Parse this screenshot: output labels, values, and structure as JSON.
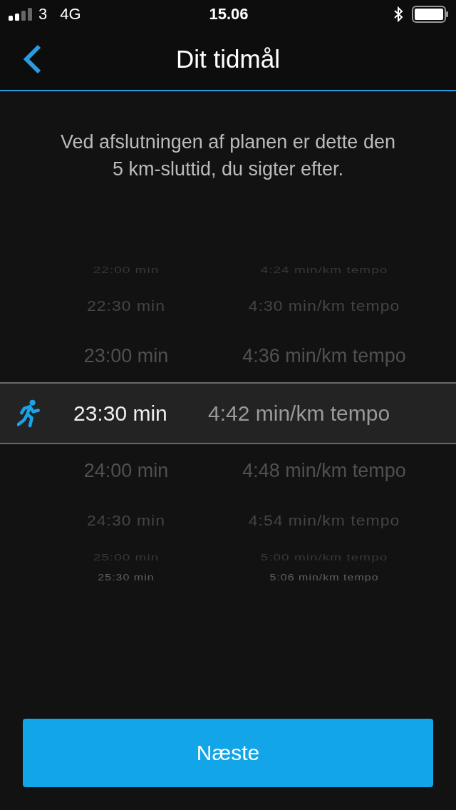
{
  "status_bar": {
    "carrier": "3",
    "network": "4G",
    "time": "15.06"
  },
  "nav": {
    "title": "Dit tidmål"
  },
  "description": "Ved afslutningen af planen er dette den 5 km-sluttid, du sigter efter.",
  "picker": [
    {
      "time": "22:00 min",
      "pace": "4:24 min/km tempo",
      "selected": false
    },
    {
      "time": "22:30 min",
      "pace": "4:30 min/km tempo",
      "selected": false
    },
    {
      "time": "23:00 min",
      "pace": "4:36 min/km tempo",
      "selected": false
    },
    {
      "time": "23:30 min",
      "pace": "4:42 min/km tempo",
      "selected": true
    },
    {
      "time": "24:00 min",
      "pace": "4:48 min/km tempo",
      "selected": false
    },
    {
      "time": "24:30 min",
      "pace": "4:54 min/km tempo",
      "selected": false
    },
    {
      "time": "25:00 min",
      "pace": "5:00 min/km tempo",
      "selected": false
    },
    {
      "time": "25:30 min",
      "pace": "5:06 min/km tempo",
      "selected": false
    }
  ],
  "button": {
    "label": "Næste"
  }
}
